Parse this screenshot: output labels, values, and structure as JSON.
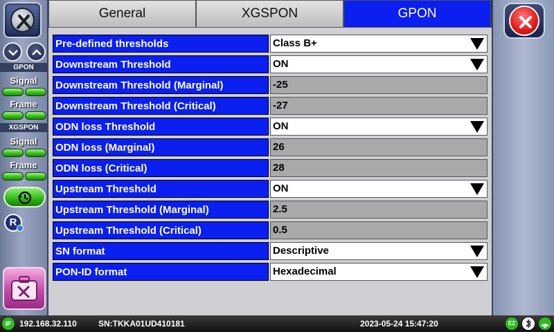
{
  "sidebar": {
    "sections": [
      {
        "title": "GPON",
        "items": [
          "Signal",
          "Frame"
        ]
      },
      {
        "title": "XGSPON",
        "items": [
          "Signal",
          "Frame"
        ]
      }
    ]
  },
  "tabs": [
    {
      "label": "General",
      "active": false
    },
    {
      "label": "XGSPON",
      "active": false
    },
    {
      "label": "GPON",
      "active": true
    }
  ],
  "settings": [
    {
      "label": "Pre-defined thresholds",
      "value": "Class B+",
      "type": "dropdown"
    },
    {
      "label": "Downstream Threshold",
      "value": "ON",
      "type": "dropdown"
    },
    {
      "label": "Downstream Threshold (Marginal)",
      "value": "-25",
      "type": "readonly"
    },
    {
      "label": "Downstream Threshold (Critical)",
      "value": "-27",
      "type": "readonly"
    },
    {
      "label": "ODN loss Threshold",
      "value": "ON",
      "type": "dropdown"
    },
    {
      "label": "ODN loss (Marginal)",
      "value": "26",
      "type": "readonly"
    },
    {
      "label": "ODN loss (Critical)",
      "value": "28",
      "type": "readonly"
    },
    {
      "label": "Upstream Threshold",
      "value": "ON",
      "type": "dropdown"
    },
    {
      "label": "Upstream Threshold (Marginal)",
      "value": "2.5",
      "type": "readonly"
    },
    {
      "label": "Upstream Threshold (Critical)",
      "value": "0.5",
      "type": "readonly"
    },
    {
      "label": "SN format",
      "value": "Descriptive",
      "type": "dropdown"
    },
    {
      "label": "PON-ID format",
      "value": "Hexadecimal",
      "type": "dropdown"
    }
  ],
  "status_bar": {
    "ip_icon_label": "IP",
    "ip": "192.168.32.110",
    "serial": "SN:TKKA01UD410181",
    "datetime": "2023-05-24  15:47:20",
    "ez_icon_label": "EZ",
    "icons": [
      "ez-icon",
      "bluetooth-icon",
      "wifi-icon"
    ]
  },
  "colors": {
    "accent_blue": "#0a1ff0",
    "led_green": "#39c21a",
    "close_red": "#e01818"
  }
}
